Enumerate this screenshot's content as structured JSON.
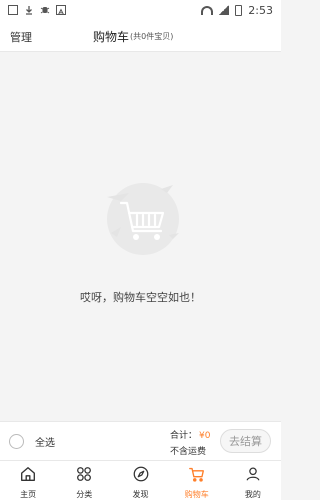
{
  "status_bar": {
    "time": "2:53",
    "icons": [
      "download-icon",
      "bug-icon",
      "a-icon",
      "wifi-icon",
      "signal-icon",
      "battery-icon"
    ]
  },
  "header": {
    "manage_label": "管理",
    "title": "购物车",
    "subtitle": "(共0件宝贝)"
  },
  "empty_state": {
    "message": "哎呀，购物车空空如也！",
    "icon": "empty-cart-icon"
  },
  "bottom_bar": {
    "select_all_label": "全选",
    "total_label": "合计：",
    "total_amount": "¥0",
    "shipping_label": "不含运费",
    "checkout_label": "去结算"
  },
  "tabbar": {
    "items": [
      {
        "label": "主页",
        "icon": "home-icon"
      },
      {
        "label": "分类",
        "icon": "category-icon"
      },
      {
        "label": "发现",
        "icon": "compass-icon"
      },
      {
        "label": "购物车",
        "icon": "cart-icon"
      },
      {
        "label": "我的",
        "icon": "user-icon"
      }
    ],
    "active_index": 3
  },
  "colors": {
    "accent": "#ff7f2a",
    "background": "#f4f4f4"
  }
}
